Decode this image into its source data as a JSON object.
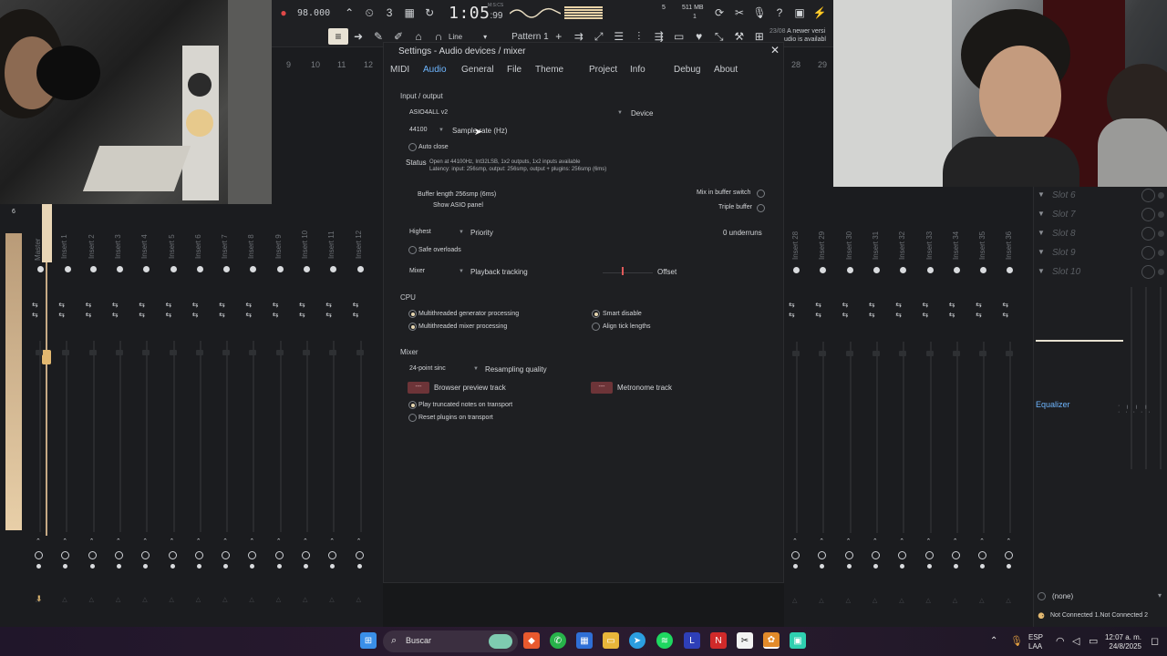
{
  "toolbar": {
    "tempo": "98.000",
    "time": "1:05",
    "time_sub": ":99",
    "time_unit": "M:S:CS",
    "memory": "511 MB",
    "cpu_voices": "5",
    "cpu_voices2": "1",
    "snap": "Line",
    "pattern": "Pattern 1",
    "news_date": "23/08",
    "news_text1": "A newer versi",
    "news_text2": "udio is availabl"
  },
  "mixer": {
    "left_numbers": [
      "9",
      "10",
      "11",
      "12"
    ],
    "right_numbers": [
      "28",
      "29"
    ],
    "strip_labels": [
      "Master",
      "Insert 1",
      "Insert 2",
      "Insert 3",
      "Insert 4",
      "Insert 5",
      "Insert 6",
      "Insert 7",
      "Insert 8",
      "Insert 9",
      "Insert 10",
      "Insert 11",
      "Insert 12"
    ],
    "right_strip_labels": [
      "Insert 28",
      "Insert 29",
      "Insert 30",
      "Insert 31",
      "Insert 32",
      "Insert 33",
      "Insert 34",
      "Insert 35",
      "Insert 36"
    ],
    "level_marker": "6"
  },
  "slots": {
    "items": [
      "Slot 6",
      "Slot 7",
      "Slot 8",
      "Slot 9",
      "Slot 10"
    ],
    "equalizer": "Equalizer",
    "output": "(none)",
    "status": "Not Connected 1.Not Connected 2"
  },
  "dialog": {
    "title": "Settings - Audio devices / mixer",
    "tabs": [
      "MIDI",
      "Audio",
      "General",
      "File",
      "Theme",
      "Project",
      "Info",
      "Debug",
      "About"
    ],
    "active_tab": "Audio",
    "input_output": {
      "heading": "Input / output",
      "device_value": "ASIO4ALL v2",
      "device_label": "Device",
      "sample_rate_value": "44100",
      "sample_rate_label": "Sample rate (Hz)",
      "auto_close": "Auto close",
      "status_label": "Status",
      "status_line1": "Open at 44100Hz, Int32LSB, 1x2 outputs, 1x2 inputs available",
      "status_line2": "Latency: input: 256smp, output: 256smp, output + plugins: 256smp (6ms)",
      "buffer_length": "Buffer length 256smp (6ms)",
      "show_asio": "Show ASIO panel",
      "mix_in_buffer": "Mix in buffer switch",
      "triple_buffer": "Triple buffer",
      "priority_value": "Highest",
      "priority_label": "Priority",
      "underruns": "0 underruns",
      "safe_overloads": "Safe overloads",
      "playback_value": "Mixer",
      "playback_label": "Playback tracking",
      "offset_label": "Offset"
    },
    "cpu": {
      "heading": "CPU",
      "multi_gen": "Multithreaded generator processing",
      "multi_mix": "Multithreaded mixer processing",
      "smart_disable": "Smart disable",
      "align_tick": "Align tick lengths"
    },
    "mixer": {
      "heading": "Mixer",
      "resample_value": "24-point sinc",
      "resample_label": "Resampling quality",
      "browser_preview_btn": "---",
      "browser_preview": "Browser preview track",
      "metronome_btn": "---",
      "metronome": "Metronome track",
      "play_truncated": "Play truncated notes on transport",
      "reset_plugins": "Reset plugins on transport"
    }
  },
  "taskbar": {
    "search_placeholder": "Buscar",
    "lang1": "ESP",
    "lang2": "LAA",
    "time": "12:07 a. m.",
    "date": "24/8/2025"
  }
}
